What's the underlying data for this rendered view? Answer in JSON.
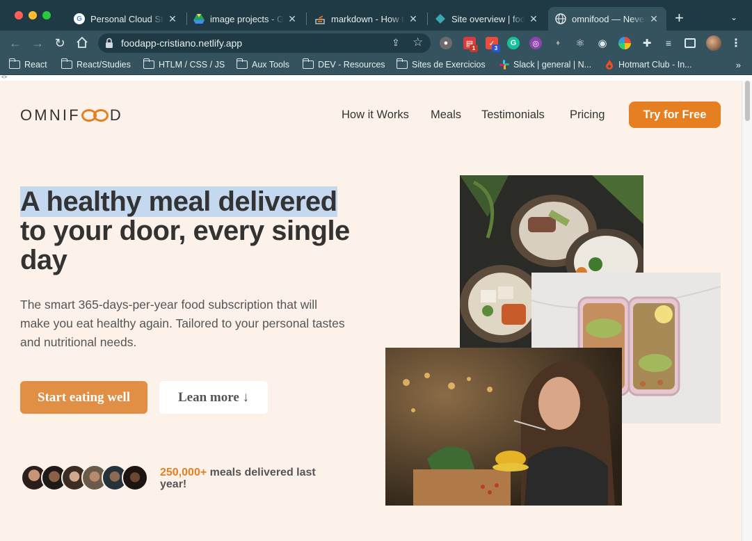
{
  "browser": {
    "tabs": [
      {
        "title": "Personal Cloud Sto",
        "icon": "google-icon"
      },
      {
        "title": "image projects - Go",
        "icon": "google-drive-icon"
      },
      {
        "title": "markdown - How to",
        "icon": "stackoverflow-icon"
      },
      {
        "title": "Site overview | foo",
        "icon": "netlify-icon"
      },
      {
        "title": "omnifood — Never",
        "icon": "globe-icon",
        "active": true
      }
    ],
    "url": "foodapp-cristiano.netlify.app",
    "extension_badges": {
      "first": "1",
      "second": "3"
    },
    "bookmarks": [
      {
        "label": "React",
        "type": "folder"
      },
      {
        "label": "React/Studies",
        "type": "folder"
      },
      {
        "label": "HTLM / CSS / JS",
        "type": "folder"
      },
      {
        "label": "Aux Tools",
        "type": "folder"
      },
      {
        "label": "DEV - Resources",
        "type": "folder"
      },
      {
        "label": "Sites de Exercicios",
        "type": "folder"
      },
      {
        "label": "Slack | general | N...",
        "type": "slack-icon"
      },
      {
        "label": "Hotmart Club - In...",
        "type": "hotmart-icon"
      }
    ],
    "more_bookmarks": "»",
    "devtools_marker": "<>"
  },
  "site": {
    "logo_left": "OMNIF",
    "logo_right": "D",
    "nav": [
      "How it Works",
      "Meals",
      "Testimonials",
      "Pricing"
    ],
    "cta": "Try for Free",
    "hero": {
      "title_line1": "A healthy meal delivered",
      "title_rest": "to your door, every single day",
      "description": "The smart 365-days-per-year food subscription that will make you eat healthy again. Tailored to your personal tastes and nutritional needs.",
      "primary_button": "Start eating well",
      "secondary_button": "Lean more ↓"
    },
    "delivered": {
      "number": "250,000+",
      "text": "meals delivered last year!"
    }
  },
  "colors": {
    "accent": "#e67e22",
    "page_bg": "#fdf2e9",
    "chrome": "#1f3a44",
    "highlight": "#c4d8f0"
  }
}
